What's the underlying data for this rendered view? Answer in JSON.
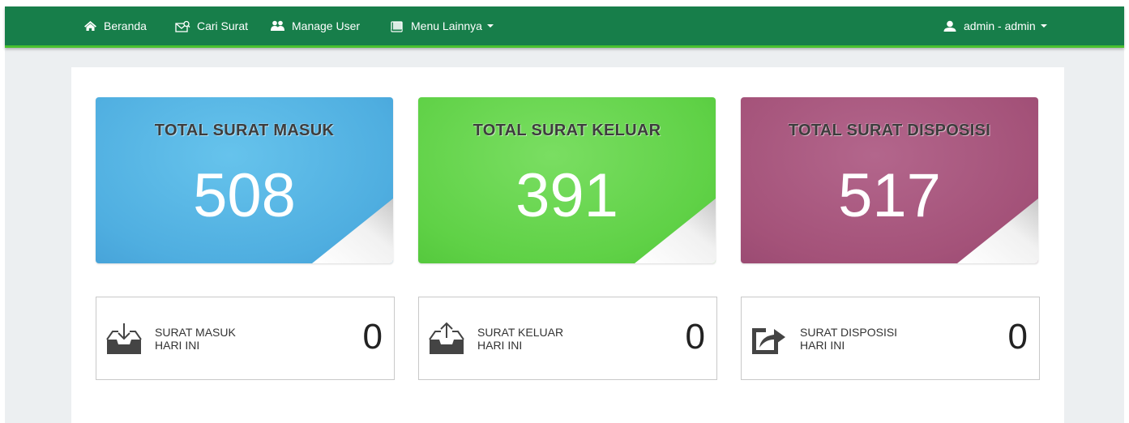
{
  "navbar": {
    "items": [
      {
        "label": "Beranda",
        "icon": "home-icon"
      },
      {
        "label": "Cari Surat",
        "icon": "envelope-search-icon"
      },
      {
        "label": "Manage User",
        "icon": "users-icon"
      },
      {
        "label": "Menu Lainnya",
        "icon": "book-icon"
      }
    ],
    "user_label": "admin - admin",
    "user_icon": "user-icon",
    "colors": {
      "bar": "#177e4a",
      "accent_line": "#49c12f"
    }
  },
  "stats": [
    {
      "title": "TOTAL SURAT MASUK",
      "value": "508",
      "color": "#4faee0"
    },
    {
      "title": "TOTAL SURAT KELUAR",
      "value": "391",
      "color": "#5fd146"
    },
    {
      "title": "TOTAL SURAT DISPOSISI",
      "value": "517",
      "color": "#a45279"
    }
  ],
  "today": [
    {
      "line1": "SURAT MASUK",
      "line2": "HARI INI",
      "count": "0",
      "icon": "inbox-download-icon"
    },
    {
      "line1": "SURAT KELUAR",
      "line2": "HARI INI",
      "count": "0",
      "icon": "inbox-upload-icon"
    },
    {
      "line1": "SURAT DISPOSISI",
      "line2": "HARI INI",
      "count": "0",
      "icon": "share-icon"
    }
  ]
}
